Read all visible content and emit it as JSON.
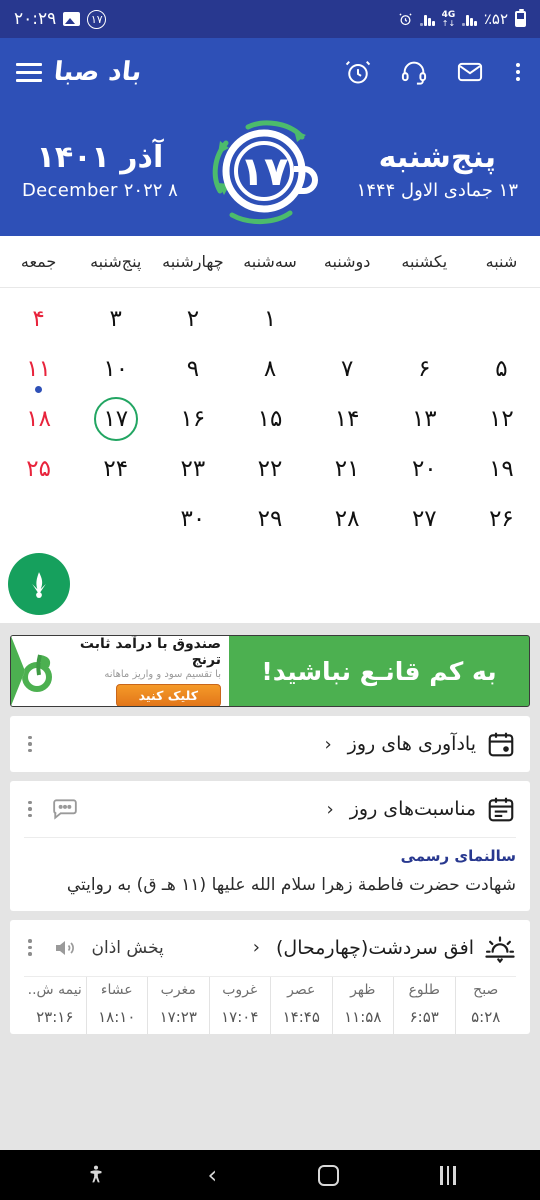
{
  "status_bar": {
    "battery_text": "٪۵۲",
    "network_type": "4G",
    "alarm_icon": "alarm-icon",
    "badge_count": "۱۷",
    "time": "۲۰:۲۹"
  },
  "app_bar": {
    "overflow_icon": "kebab-menu-icon",
    "mail_icon": "envelope-icon",
    "support_icon": "headset-icon",
    "alarm_icon": "alarm-clock-icon",
    "logo_text": "باد صبا",
    "menu_icon": "hamburger-icon"
  },
  "hero": {
    "gregorian_month_year": "آذر ۱۴۰۱",
    "gregorian_date": "۸ December ۲۰۲۲",
    "weekday": "پنج‌شنبه",
    "hijri_date": "۱۳ جمادی الاول ۱۴۴۴",
    "logo_day": "۱۷",
    "logo_name": "cup-logo-icon"
  },
  "calendar": {
    "weekdays": [
      "شنبه",
      "یکشنبه",
      "دوشنبه",
      "سه‌شنبه",
      "چهارشنبه",
      "پنج‌شنبه",
      "جمعه"
    ],
    "weeks": [
      [
        {
          "label": "",
          "holiday": false,
          "today": false,
          "event": false
        },
        {
          "label": "",
          "holiday": false,
          "today": false,
          "event": false
        },
        {
          "label": "",
          "holiday": false,
          "today": false,
          "event": false
        },
        {
          "label": "۱",
          "holiday": false,
          "today": false,
          "event": false
        },
        {
          "label": "۲",
          "holiday": false,
          "today": false,
          "event": false
        },
        {
          "label": "۳",
          "holiday": false,
          "today": false,
          "event": false
        },
        {
          "label": "۴",
          "holiday": true,
          "today": false,
          "event": false
        }
      ],
      [
        {
          "label": "۵",
          "holiday": false,
          "today": false,
          "event": false
        },
        {
          "label": "۶",
          "holiday": false,
          "today": false,
          "event": false
        },
        {
          "label": "۷",
          "holiday": false,
          "today": false,
          "event": false
        },
        {
          "label": "۸",
          "holiday": false,
          "today": false,
          "event": false
        },
        {
          "label": "۹",
          "holiday": false,
          "today": false,
          "event": false
        },
        {
          "label": "۱۰",
          "holiday": false,
          "today": false,
          "event": false
        },
        {
          "label": "۱۱",
          "holiday": true,
          "today": false,
          "event": true
        }
      ],
      [
        {
          "label": "۱۲",
          "holiday": false,
          "today": false,
          "event": false
        },
        {
          "label": "۱۳",
          "holiday": false,
          "today": false,
          "event": false
        },
        {
          "label": "۱۴",
          "holiday": false,
          "today": false,
          "event": false
        },
        {
          "label": "۱۵",
          "holiday": false,
          "today": false,
          "event": false
        },
        {
          "label": "۱۶",
          "holiday": false,
          "today": false,
          "event": false
        },
        {
          "label": "۱۷",
          "holiday": false,
          "today": true,
          "event": false
        },
        {
          "label": "۱۸",
          "holiday": true,
          "today": false,
          "event": false
        }
      ],
      [
        {
          "label": "۱۹",
          "holiday": false,
          "today": false,
          "event": false
        },
        {
          "label": "۲۰",
          "holiday": false,
          "today": false,
          "event": false
        },
        {
          "label": "۲۱",
          "holiday": false,
          "today": false,
          "event": false
        },
        {
          "label": "۲۲",
          "holiday": false,
          "today": false,
          "event": false
        },
        {
          "label": "۲۳",
          "holiday": false,
          "today": false,
          "event": false
        },
        {
          "label": "۲۴",
          "holiday": false,
          "today": false,
          "event": false
        },
        {
          "label": "۲۵",
          "holiday": true,
          "today": false,
          "event": false
        }
      ],
      [
        {
          "label": "۲۶",
          "holiday": false,
          "today": false,
          "event": false
        },
        {
          "label": "۲۷",
          "holiday": false,
          "today": false,
          "event": false
        },
        {
          "label": "۲۸",
          "holiday": false,
          "today": false,
          "event": false
        },
        {
          "label": "۲۹",
          "holiday": false,
          "today": false,
          "event": false
        },
        {
          "label": "۳۰",
          "holiday": false,
          "today": false,
          "event": false
        },
        {
          "label": "",
          "holiday": false,
          "today": false,
          "event": false
        },
        {
          "label": "",
          "holiday": false,
          "today": false,
          "event": false
        }
      ]
    ],
    "fab_icon": "download-arrow-icon",
    "today_ring_color": "#22a562",
    "holiday_color": "#e8243c",
    "event_dot_color": "#2e50b7"
  },
  "ad": {
    "slogan": "به کم قانـع نباشید!",
    "title": "صندوق با درآمد ثابت ترنج",
    "subtitle": "با تقسیم سود و واریز ماهانه",
    "button_label": "کلیک کنید",
    "brand_icon": "toranj-logo-icon",
    "bg_color": "#4cb050",
    "button_color": "#e2761a"
  },
  "reminders_card": {
    "icon": "calendar-dot-icon",
    "title": "یادآوری های روز",
    "chevron": "‹",
    "overflow_icon": "kebab-menu-icon"
  },
  "occasions_card": {
    "icon": "calendar-list-icon",
    "title": "مناسبت‌های روز",
    "chevron": "‹",
    "comment_icon": "comment-icon",
    "overflow_icon": "kebab-menu-icon",
    "source": "سالنمای رسمی",
    "text": "شهادت حضرت فاطمة زهرا سلام الله علیها (۱۱ هـ ق) به روایتي"
  },
  "prayer_card": {
    "icon": "sunrise-icon",
    "location": "افق سردشت(چهارمحال)",
    "chevron": "‹",
    "azan_label": "پخش اذان",
    "speaker_icon": "speaker-icon",
    "overflow_icon": "kebab-menu-icon",
    "columns": [
      "صبح",
      "طلوع",
      "ظهر",
      "عصر",
      "غروب",
      "مغرب",
      "عشاء",
      "نیمه ش.."
    ],
    "values": [
      "۵:۲۸",
      "۶:۵۳",
      "۱۱:۵۸",
      "۱۴:۴۵",
      "۱۷:۰۴",
      "۱۷:۲۳",
      "۱۸:۱۰",
      "۲۳:۱۶"
    ]
  },
  "nav_bar": {
    "recents_icon": "recents-icon",
    "home_icon": "home-icon",
    "back_icon": "back-icon",
    "accessibility_icon": "accessibility-icon"
  }
}
